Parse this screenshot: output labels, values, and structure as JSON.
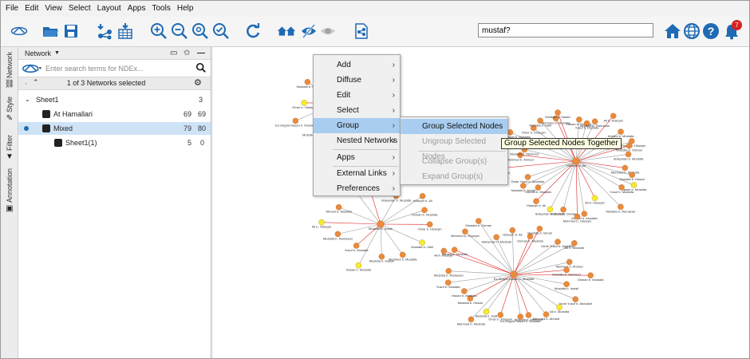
{
  "menubar": {
    "items": [
      "File",
      "Edit",
      "View",
      "Select",
      "Layout",
      "Apps",
      "Tools",
      "Help"
    ]
  },
  "toolbar": {
    "search_value": "mustaf?",
    "notification_count": "7",
    "icons": [
      "cytoscape-logo-icon",
      "open-folder-icon",
      "save-icon",
      "import-network-icon",
      "import-table-icon",
      "zoom-in-icon",
      "zoom-out-icon",
      "zoom-selected-icon",
      "zoom-fit-icon",
      "refresh-icon",
      "first-neighbors-icon",
      "hide-selected-icon",
      "show-all-icon",
      "new-network-from-selection-icon",
      "home-icon",
      "web-icon",
      "help-icon",
      "notifications-icon"
    ]
  },
  "side_tabs": [
    "Network",
    "Style",
    "Filter",
    "Annotation"
  ],
  "network_panel": {
    "title": "Network",
    "ndex_placeholder": "Enter search terms for NDEx...",
    "selection_status": "1 of 3 Networks selected",
    "tree": [
      {
        "name": "Sheet1",
        "count_a": "3",
        "count_b": ""
      },
      {
        "name": "At Hamallari",
        "count_a": "69",
        "count_b": "69"
      },
      {
        "name": "Mixed",
        "count_a": "79",
        "count_b": "80"
      },
      {
        "name": "Sheet1(1)",
        "count_a": "5",
        "count_b": "0"
      }
    ]
  },
  "context_menu": {
    "items": [
      {
        "label": "Add",
        "has_submenu": true
      },
      {
        "label": "Diffuse",
        "has_submenu": true
      },
      {
        "label": "Edit",
        "has_submenu": true
      },
      {
        "label": "Select",
        "has_submenu": true
      },
      {
        "label": "Group",
        "has_submenu": true,
        "active": true
      },
      {
        "label": "Nested Networks",
        "has_submenu": true
      },
      {
        "label": "Apps",
        "has_submenu": true
      },
      {
        "label": "External Links",
        "has_submenu": true
      },
      {
        "label": "Preferences",
        "has_submenu": true
      }
    ],
    "submenu": [
      {
        "label": "Group Selected Nodes",
        "active": true
      },
      {
        "label": "Ungroup Selected Nodes",
        "disabled": true
      },
      {
        "label": "Collapse Group(s)",
        "disabled": true
      },
      {
        "label": "Expand Group(s)",
        "disabled": true
      }
    ],
    "tooltip": "Group Selected Nodes Together"
  },
  "colors": {
    "node_orange": "#e98a3c",
    "node_yellow": "#f3ec2a",
    "edge_gray": "#9a9a9a",
    "edge_red": "#e02020",
    "menu_highlight": "#a9cdf0",
    "accent_blue": "#1f6ab4"
  },
  "network_labels": [
    "Mehmed b. Mustafa",
    "Mustafa b. Hasan",
    "Hasan b. Mustafa",
    "Yusuf b. Mustafa",
    "Mustafa b. Ramazan",
    "Ali b. Hüseyin",
    "Ahmed b. Mustafa",
    "Mehmed b. Hüseyin",
    "Mustafa b. Osman",
    "Süleyman b. Mustafa",
    "Hüseyin b. Ali",
    "Osman b. Mustafa",
    "Mustafa b. İsmail",
    "Dede Yusuf b. Abdullah",
    "Ali b. Mustafa",
    "Mehmed b. Ahmed",
    "Mustafa b. Mehmed",
    "Es-Seyyid Hasan b. Mustafa",
    "Ömer b. Hüseyin",
    "Mustafa b. Halil"
  ]
}
